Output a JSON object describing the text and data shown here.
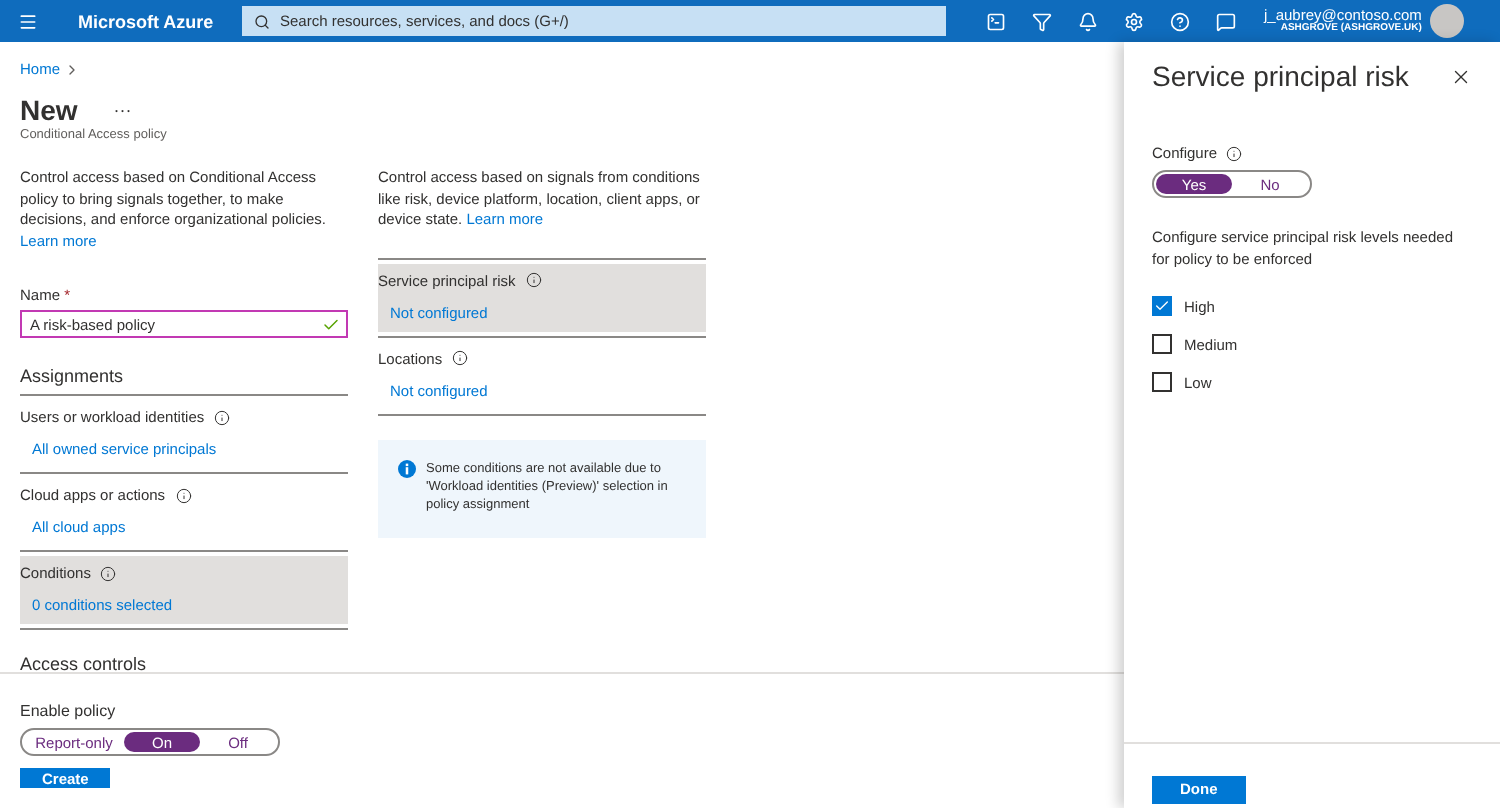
{
  "top_bar": {
    "brand": "Microsoft Azure",
    "search": {
      "placeholder": "Search resources, services, and docs (G+/)"
    },
    "user": {
      "email": "j_aubrey@contoso.com",
      "tenant": "ASHGROVE (ASHGROVE.UK)"
    }
  },
  "breadcrumb": [
    "Home"
  ],
  "page": {
    "title": "New",
    "more": "···",
    "subtitle": "Conditional Access policy"
  },
  "left_column": {
    "intro": "Control access based on Conditional Access policy to bring signals together, to make decisions, and enforce organizational policies.",
    "learn_more": "Learn more",
    "name_field": {
      "label": "Name",
      "required": "*",
      "value": "A risk-based policy"
    },
    "heading": "Assignments",
    "items": [
      {
        "label": "Users or workload identities",
        "value": "All owned service principals",
        "selected": false
      },
      {
        "label": "Cloud apps or actions",
        "value": "All cloud apps",
        "selected": false
      },
      {
        "label": "Conditions",
        "value": "0 conditions selected",
        "selected": true
      }
    ],
    "next_heading": "Access controls"
  },
  "right_column": {
    "intro": "Control access based on signals from conditions like risk, device platform, location, client apps, or device state.",
    "learn_more": "Learn more",
    "items": [
      {
        "label": "Service principal risk",
        "value": "Not configured",
        "selected": true
      },
      {
        "label": "Locations",
        "value": "Not configured",
        "selected": false
      }
    ],
    "notice": "Some conditions are not available due to 'Workload identities (Preview)' selection in policy assignment"
  },
  "footer": {
    "label": "Enable policy",
    "toggle": [
      {
        "label": "Report-only",
        "selected": false
      },
      {
        "label": "On",
        "selected": true
      },
      {
        "label": "Off",
        "selected": false
      }
    ],
    "button": "Create"
  },
  "panel": {
    "title": "Service principal risk",
    "configure_label": "Configure",
    "configure_toggle": [
      {
        "label": "Yes",
        "selected": true
      },
      {
        "label": "No",
        "selected": false
      }
    ],
    "description": "Configure service principal risk levels needed for policy to be enforced",
    "levels": [
      {
        "label": "High",
        "checked": true
      },
      {
        "label": "Medium",
        "checked": false
      },
      {
        "label": "Low",
        "checked": false
      }
    ],
    "button": "Done"
  }
}
